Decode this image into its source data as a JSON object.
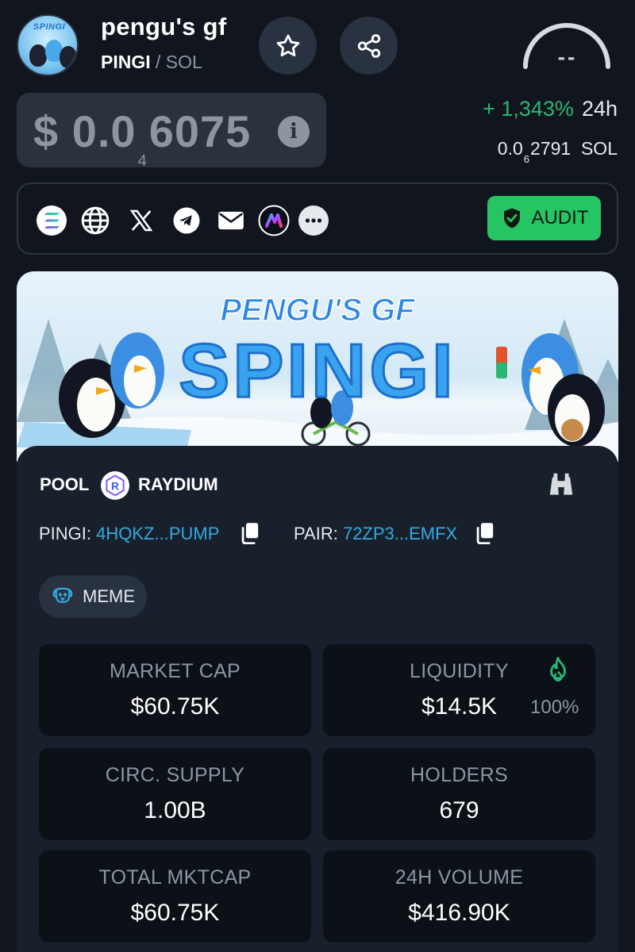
{
  "token": {
    "name": "pengu's gf",
    "symbol": "PINGI",
    "quote_sep": " / ",
    "quote": "SOL",
    "avatar_text": "SPINGI"
  },
  "gauge": {
    "value": "--"
  },
  "price": {
    "prefix": "$ 0.0",
    "zeros": "4",
    "digits": "6075",
    "change": "+ 1,343%",
    "period": "24h",
    "sol_prefix": "0.0",
    "sol_zeros": "6",
    "sol_digits": "2791",
    "sol_unit": "SOL"
  },
  "links": {
    "icons": [
      "solana-icon",
      "globe-icon",
      "x-icon",
      "telegram-icon",
      "email-icon",
      "dex-icon",
      "more-icon"
    ],
    "audit_label": "AUDIT"
  },
  "banner": {
    "title_top": "PENGU'S GF",
    "title_main": "SPINGI"
  },
  "pool": {
    "label": "POOL",
    "dex": "RAYDIUM",
    "token_key": "PINGI:",
    "token_addr": "4HQKZ...PUMP",
    "pair_key": "PAIR:",
    "pair_addr": "72ZP3...EMFX",
    "tag": "MEME"
  },
  "stats": {
    "market_cap": {
      "label": "MARKET CAP",
      "value": "$60.75K"
    },
    "liquidity": {
      "label": "LIQUIDITY",
      "value": "$14.5K",
      "pct": "100%"
    },
    "circ_supply": {
      "label": "CIRC. SUPPLY",
      "value": "1.00B"
    },
    "holders": {
      "label": "HOLDERS",
      "value": "679"
    },
    "total_mktcap": {
      "label": "TOTAL MKTCAP",
      "value": "$60.75K"
    },
    "volume_24h": {
      "label": "24H VOLUME",
      "value": "$416.90K"
    }
  },
  "colors": {
    "positive": "#2bb673",
    "link": "#35a9e0",
    "audit": "#27c464",
    "background": "#11161e",
    "card": "#18202b"
  }
}
